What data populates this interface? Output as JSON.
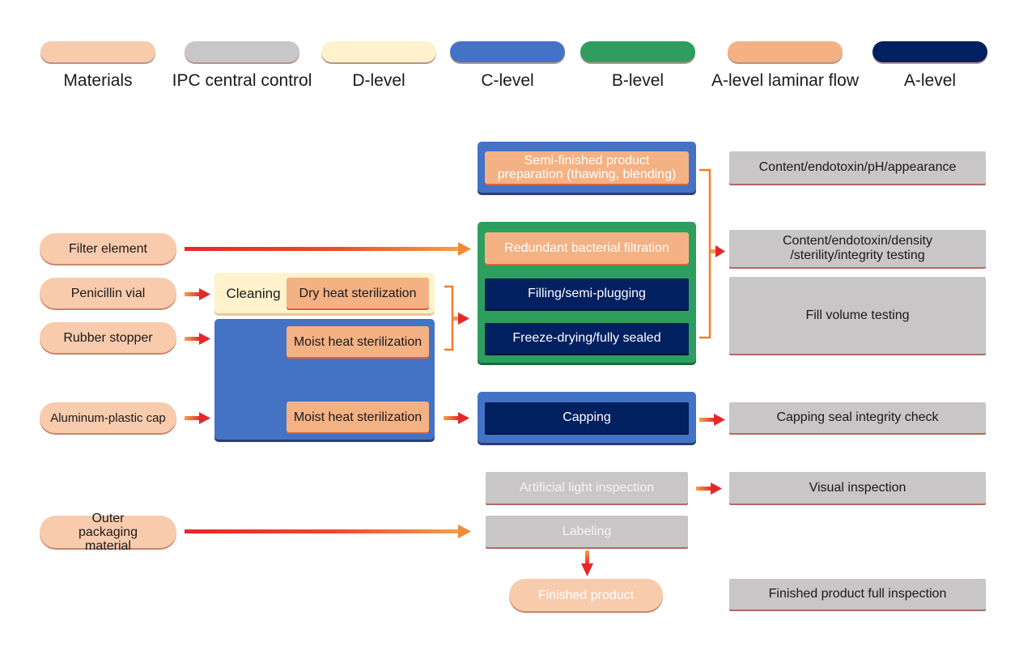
{
  "legend": [
    {
      "label": "Materials",
      "color": "#f8cbad"
    },
    {
      "label": "IPC central control",
      "color": "#c8c6c7"
    },
    {
      "label": "D-level",
      "color": "#fff2cc"
    },
    {
      "label": "C-level",
      "color": "#4472c4"
    },
    {
      "label": "B-level",
      "color": "#2e9e5e"
    },
    {
      "label": "A-level laminar flow",
      "color": "#f4b183"
    },
    {
      "label": "A-level",
      "color": "#002060"
    }
  ],
  "materials": {
    "filter_element": "Filter element",
    "penicillin_vial": "Penicillin vial",
    "rubber_stopper": "Rubber stopper",
    "aluminum_cap": "Aluminum-plastic cap",
    "outer_packaging": "Outer packaging material"
  },
  "processes": {
    "cleaning": "Cleaning",
    "dry_heat": "Dry heat sterilization",
    "moist_heat_1": "Moist heat sterilization",
    "moist_heat_2": "Moist heat sterilization",
    "semi_finished": "Semi-finished product preparation (thawing, blending)",
    "redundant_filtration": "Redundant bacterial filtration",
    "filling": "Filling/semi-plugging",
    "freeze_drying": "Freeze-drying/fully sealed",
    "capping": "Capping",
    "light_inspection": "Artificial light inspection",
    "labeling": "Labeling",
    "finished_product": "Finished product"
  },
  "ipc": {
    "content_ph": "Content/endotoxin/pH/appearance",
    "content_density": "Content/endotoxin/density /sterility/integrity testing",
    "fill_volume": "Fill volume testing",
    "capping_check": "Capping seal integrity check",
    "visual_inspection": "Visual inspection",
    "full_inspection": "Finished product full inspection"
  },
  "colors": {
    "arrow_start": "#e8262a",
    "arrow_end": "#f5a04a",
    "bracket": "#f07f2a"
  }
}
